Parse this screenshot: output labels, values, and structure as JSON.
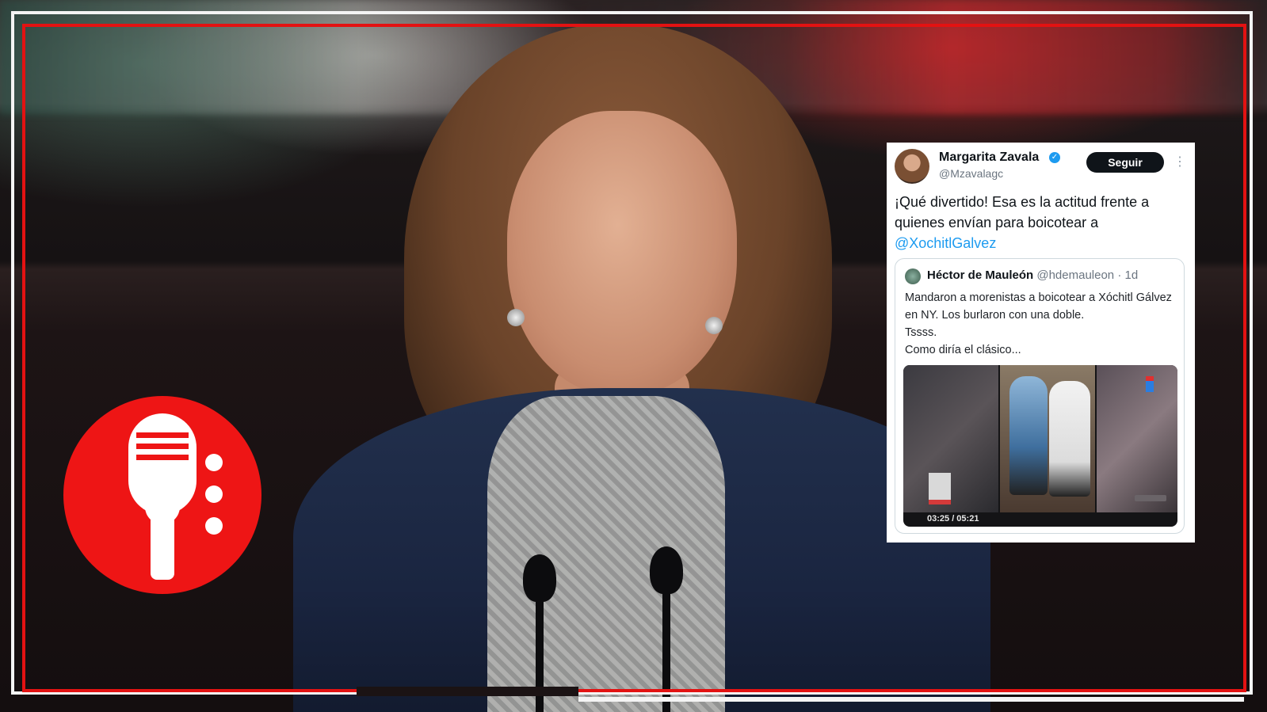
{
  "tweet": {
    "author": {
      "name": "Margarita Zavala",
      "handle": "@Mzavalagc",
      "verified_icon": "verified-badge-icon"
    },
    "follow_label": "Seguir",
    "text": "¡Qué divertido! Esa es la actitud frente a quienes envían para boicotear a",
    "mention": "@XochitlGalvez",
    "quoted": {
      "author_name": "Héctor de Mauleón",
      "handle": "@hdemauleon",
      "age": "· 1d",
      "lines": [
        "Mandaron a morenistas a boicotear a Xóchitl Gálvez en NY. Los burlaron con una doble.",
        "Tssss.",
        "Como diría el clásico..."
      ],
      "video_time": "03:25 / 05:21"
    }
  },
  "colors": {
    "frame_red": "#e31212",
    "frame_white": "#f4f4f4",
    "logo_red": "#ee1515",
    "link_blue": "#1d9bf0"
  },
  "icons": {
    "logo": "podcast-microphone-icon",
    "more": "more-icon"
  }
}
